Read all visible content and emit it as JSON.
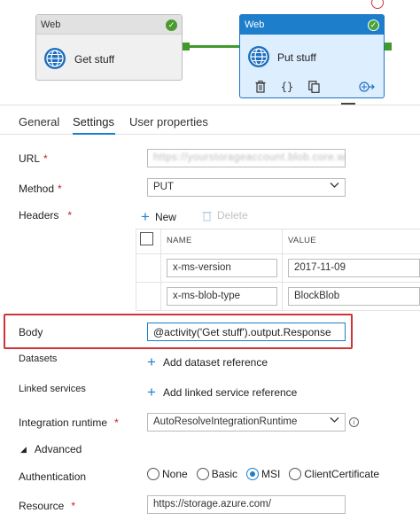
{
  "canvas": {
    "activity_get": {
      "type_label": "Web",
      "name": "Get stuff"
    },
    "activity_put": {
      "type_label": "Web",
      "name": "Put stuff"
    }
  },
  "tabs": [
    {
      "label": "General"
    },
    {
      "label": "Settings"
    },
    {
      "label": "User properties"
    }
  ],
  "form": {
    "url": {
      "label": "URL",
      "required": "*",
      "value": "https://yourstorageaccount.blob.core.windows.net"
    },
    "method": {
      "label": "Method",
      "required": "*",
      "value": "PUT"
    },
    "headers": {
      "label": "Headers",
      "required": "*",
      "new_label": "New",
      "delete_label": "Delete",
      "columns": [
        "NAME",
        "VALUE"
      ],
      "rows": [
        {
          "name": "x-ms-version",
          "value": "2017-11-09"
        },
        {
          "name": "x-ms-blob-type",
          "value": "BlockBlob"
        }
      ]
    },
    "body": {
      "label": "Body",
      "value": "@activity('Get stuff').output.Response"
    },
    "datasets": {
      "label": "Datasets",
      "add_label": "Add dataset reference"
    },
    "linked_services": {
      "label": "Linked services",
      "add_label": "Add linked service reference"
    },
    "integration_runtime": {
      "label": "Integration runtime",
      "required": "*",
      "value": "AutoResolveIntegrationRuntime"
    },
    "advanced": {
      "label": "Advanced"
    },
    "authentication": {
      "label": "Authentication",
      "options": [
        "None",
        "Basic",
        "MSI",
        "ClientCertificate"
      ],
      "selected": "MSI"
    },
    "resource": {
      "label": "Resource",
      "required": "*",
      "value": "https://storage.azure.com/"
    }
  },
  "colors": {
    "accent": "#1d7ecb",
    "success": "#4a9a2f",
    "highlight": "#d13438"
  }
}
